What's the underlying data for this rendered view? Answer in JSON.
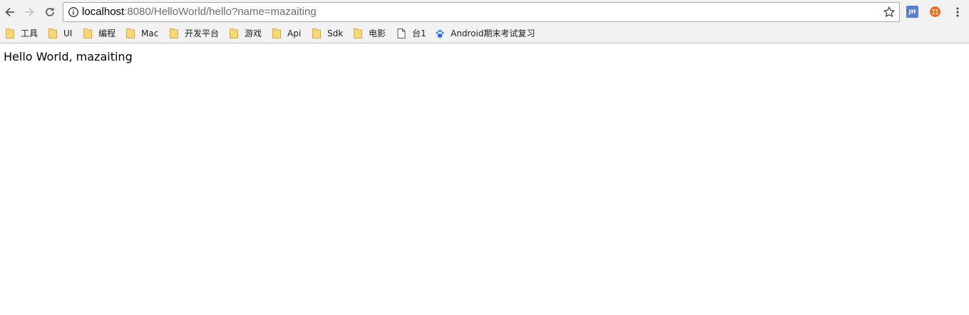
{
  "toolbar": {
    "url_host": "localhost",
    "url_rest": ":8080/HelloWorld/hello?name=mazaiting",
    "icons": {
      "back": "arrow-left-icon",
      "forward": "arrow-right-icon",
      "reload": "reload-icon",
      "info": "info-circle-icon",
      "bookmark_star": "star-outline-icon",
      "menu": "vertical-dots-icon"
    },
    "extensions": [
      {
        "name": "jh-extension",
        "label": "JH",
        "color": "#5b7fd6"
      },
      {
        "name": "orange-extension",
        "color": "#e8702a"
      }
    ]
  },
  "bookmarks": [
    {
      "label": "工具",
      "icon": "folder-icon"
    },
    {
      "label": "UI",
      "icon": "folder-icon"
    },
    {
      "label": "编程",
      "icon": "folder-icon"
    },
    {
      "label": "Mac",
      "icon": "folder-icon"
    },
    {
      "label": "开发平台",
      "icon": "folder-icon"
    },
    {
      "label": "游戏",
      "icon": "folder-icon"
    },
    {
      "label": "Api",
      "icon": "folder-icon"
    },
    {
      "label": "Sdk",
      "icon": "folder-icon"
    },
    {
      "label": "电影",
      "icon": "folder-icon"
    },
    {
      "label": "台1",
      "icon": "page-icon"
    },
    {
      "label": "Android期末考试复习",
      "icon": "baidu-paw-icon"
    }
  ],
  "page": {
    "body_text": "Hello World, mazaiting"
  },
  "colors": {
    "folder": "#f8d775",
    "folder_edge": "#d9a93a",
    "baidu": "#2c6ee6"
  }
}
